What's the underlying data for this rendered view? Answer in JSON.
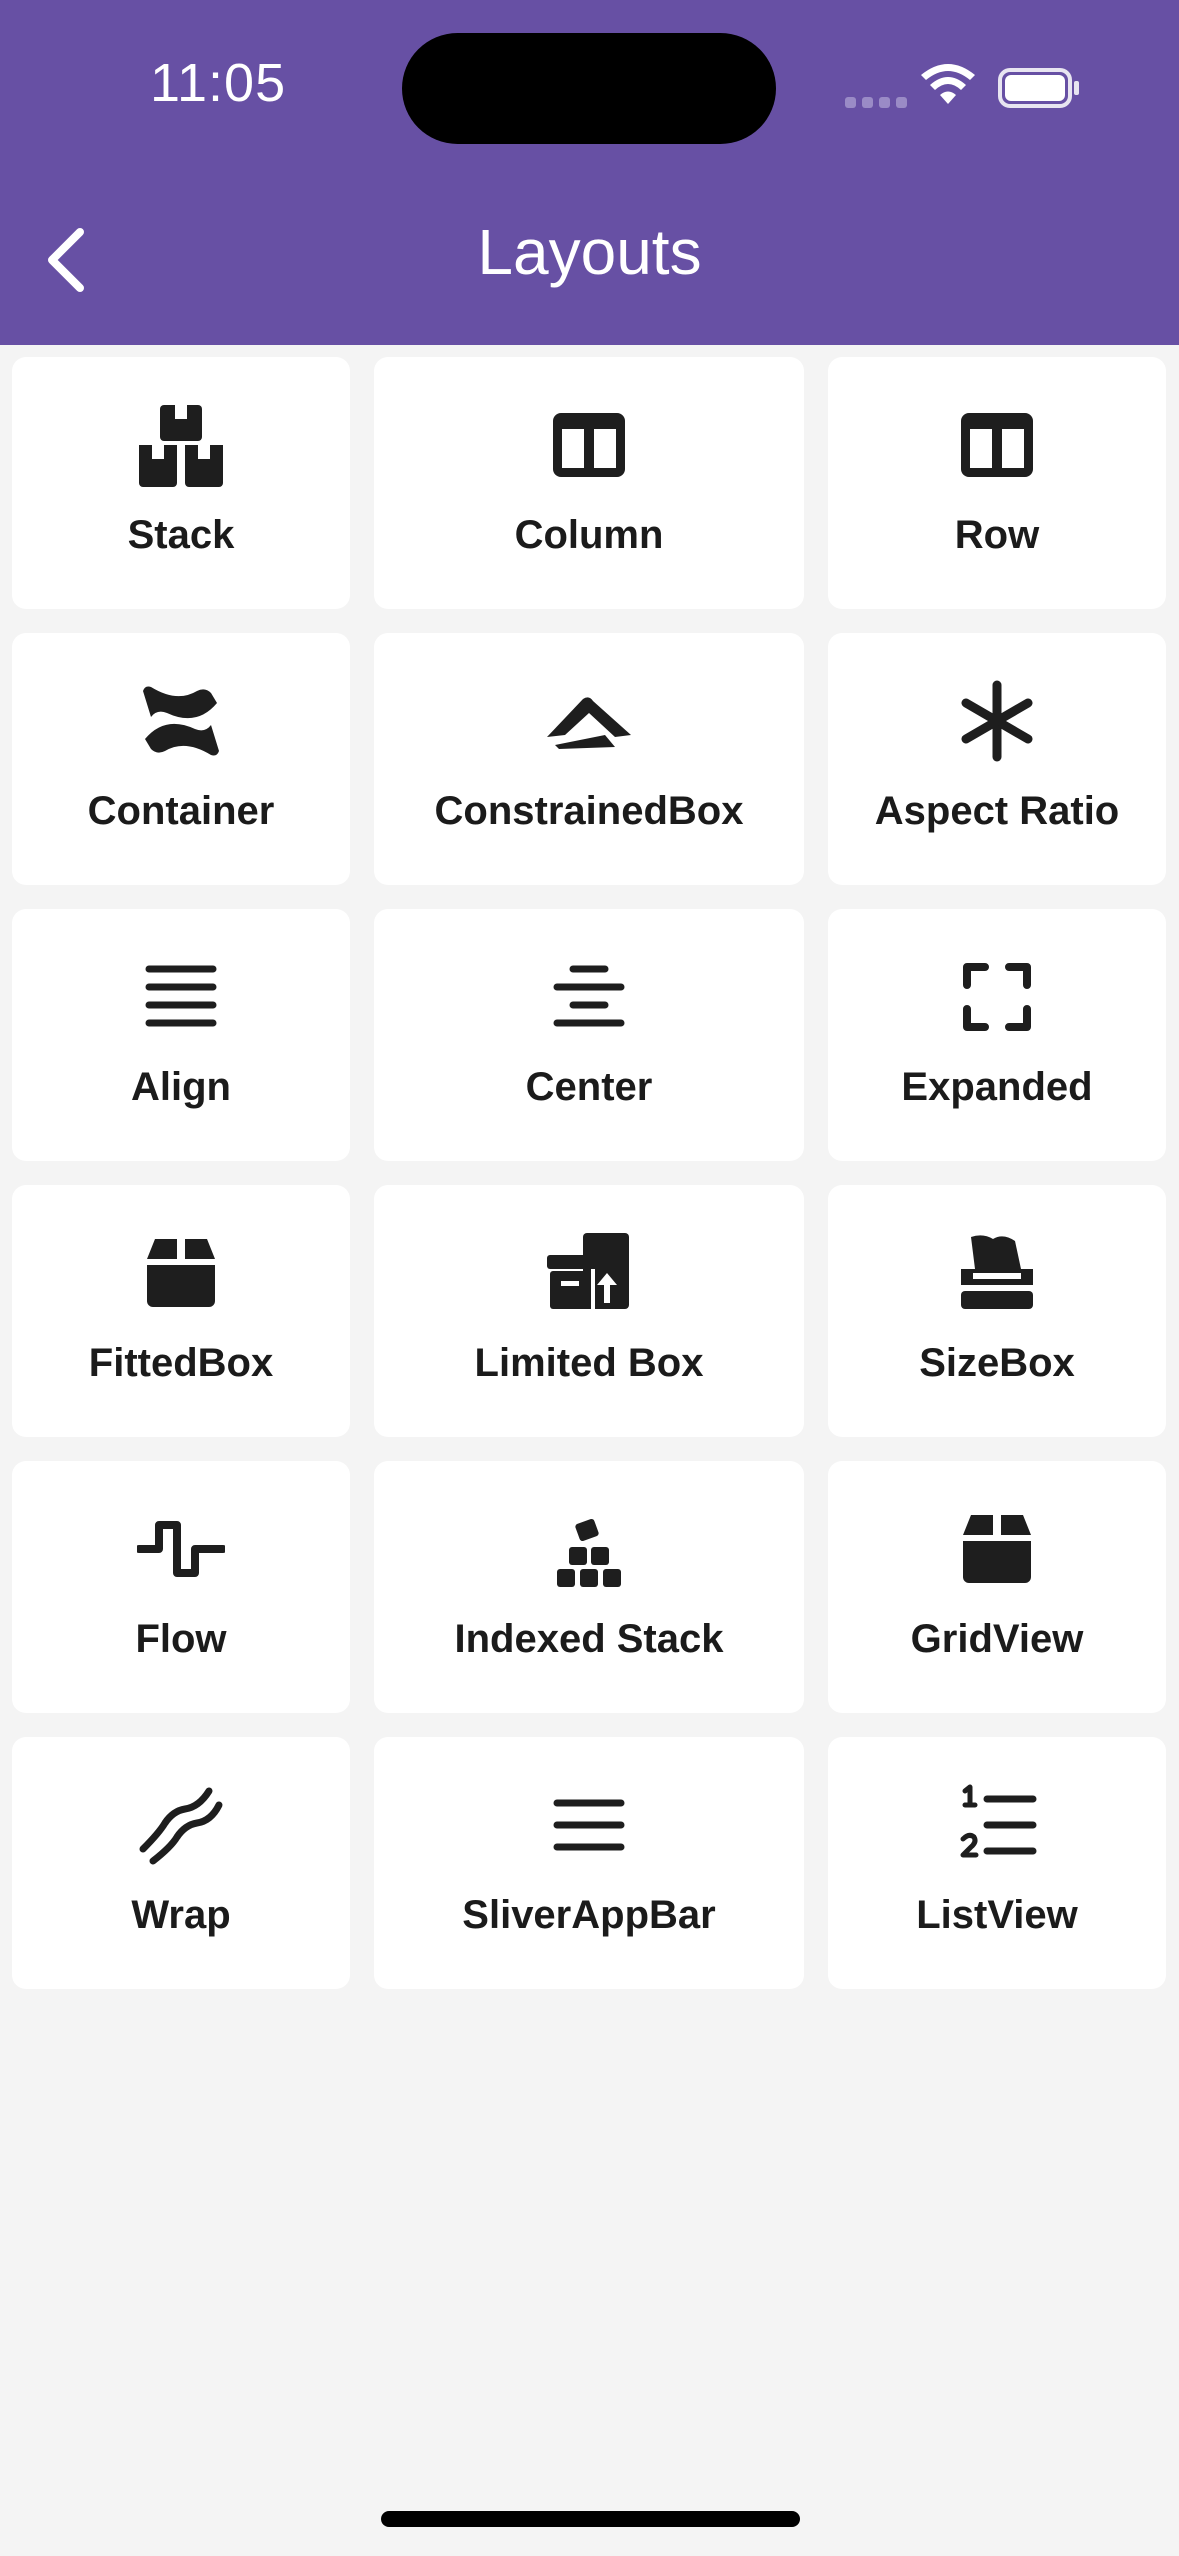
{
  "status_bar": {
    "time": "11:05"
  },
  "header": {
    "title": "Layouts",
    "back_icon": "chevron-left-icon"
  },
  "colors": {
    "appbar": "#6750a4",
    "background": "#f4f4f4",
    "tile": "#ffffff",
    "text": "#1b1b1b"
  },
  "tiles": [
    {
      "label": "Stack",
      "icon": "boxes-stacked-icon"
    },
    {
      "label": "Column",
      "icon": "columns-icon"
    },
    {
      "label": "Row",
      "icon": "columns-icon"
    },
    {
      "label": "Container",
      "icon": "confluence-icon"
    },
    {
      "label": "ConstrainedBox",
      "icon": "arrow-logo-icon"
    },
    {
      "label": "Aspect Ratio",
      "icon": "asterisk-icon"
    },
    {
      "label": "Align",
      "icon": "align-justify-icon"
    },
    {
      "label": "Center",
      "icon": "align-center-icon"
    },
    {
      "label": "Expanded",
      "icon": "expand-icon"
    },
    {
      "label": "FittedBox",
      "icon": "box-icon"
    },
    {
      "label": "Limited Box",
      "icon": "boxes-packing-icon"
    },
    {
      "label": "SizeBox",
      "icon": "box-tissue-icon"
    },
    {
      "label": "Flow",
      "icon": "wave-square-icon"
    },
    {
      "label": "Indexed Stack",
      "icon": "cubes-stacked-icon"
    },
    {
      "label": "GridView",
      "icon": "box-icon"
    },
    {
      "label": "Wrap",
      "icon": "bacon-icon"
    },
    {
      "label": "SliverAppBar",
      "icon": "bars-icon"
    },
    {
      "label": "ListView",
      "icon": "list-ol-icon"
    }
  ]
}
